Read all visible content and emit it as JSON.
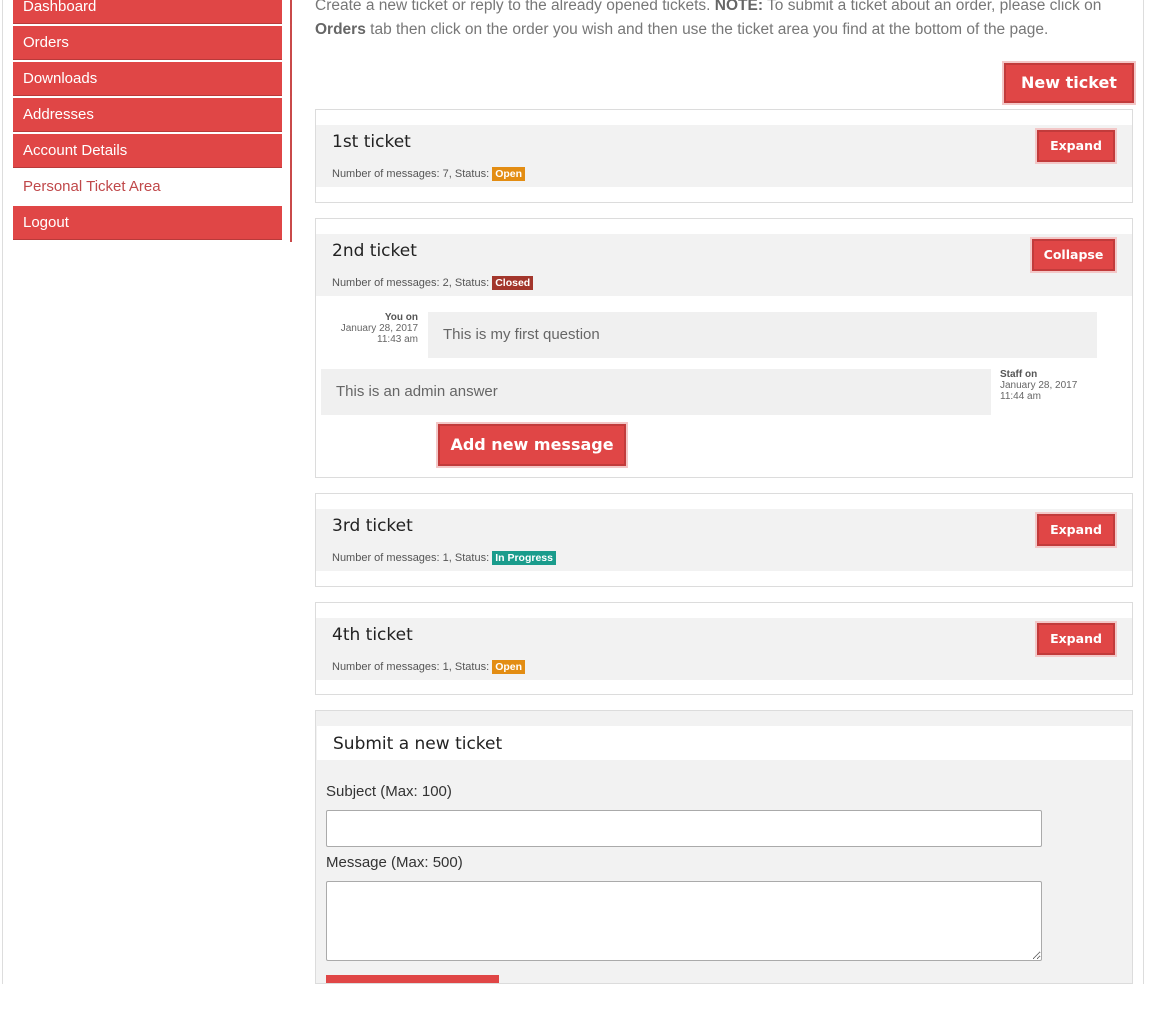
{
  "sidebar": {
    "items": [
      {
        "label": "Dashboard"
      },
      {
        "label": "Orders"
      },
      {
        "label": "Downloads"
      },
      {
        "label": "Addresses"
      },
      {
        "label": "Account Details"
      },
      {
        "label": "Personal Ticket Area"
      },
      {
        "label": "Logout"
      }
    ]
  },
  "intro": {
    "part1": "Create a new ticket or reply to the already opened tickets. ",
    "note": "NOTE:",
    "part2": " To submit a ticket about an order, please click on ",
    "orders": "Orders",
    "part3": " tab then click on the order you wish and then use the ticket area you find at the bottom of the page."
  },
  "new_ticket_label": "New ticket",
  "meta_prefix": "Number of messages: ",
  "status_prefix": ", Status: ",
  "tickets": [
    {
      "title": "1st ticket",
      "count": "7",
      "status": "Open",
      "status_color": "#e38d13",
      "button": "Expand"
    },
    {
      "title": "2nd ticket",
      "count": "2",
      "status": "Closed",
      "status_color": "#a3362c",
      "button": "Collapse",
      "messages": [
        {
          "author": "You on",
          "date": "January 28, 2017",
          "time": "11:43 am",
          "text": "This is my first question"
        },
        {
          "author": "Staff on",
          "date": "January 28, 2017",
          "time": "11:44 am",
          "text": "This is an admin answer"
        }
      ],
      "add_message_label": "Add new message"
    },
    {
      "title": "3rd ticket",
      "count": "1",
      "status": "In Progress",
      "status_color": "#1a9c8c",
      "button": "Expand"
    },
    {
      "title": "4th ticket",
      "count": "1",
      "status": "Open",
      "status_color": "#e38d13",
      "button": "Expand"
    }
  ],
  "form": {
    "title": "Submit a new ticket",
    "subject_label": "Subject (Max: 100)",
    "subject_value": "",
    "message_label": "Message (Max: 500)",
    "message_value": ""
  }
}
